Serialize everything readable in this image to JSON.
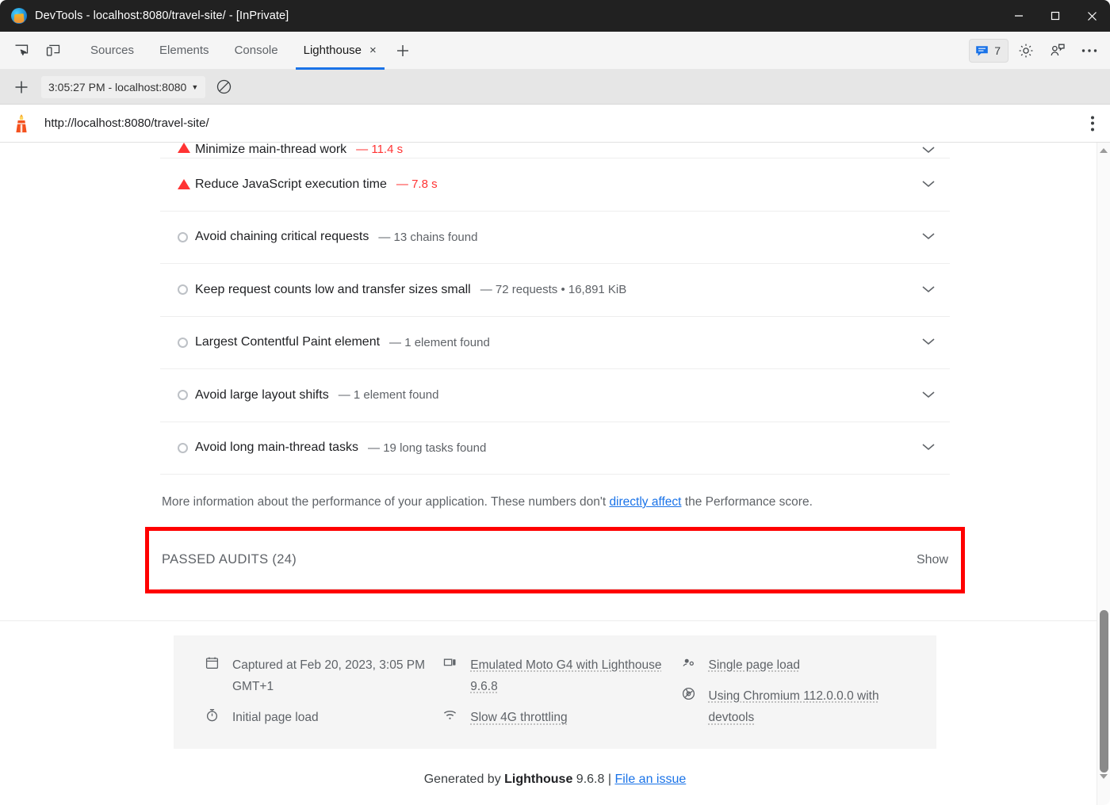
{
  "window": {
    "title": "DevTools - localhost:8080/travel-site/ - [InPrivate]",
    "logo_icon": "edge-logo-icon",
    "minimize_icon": "minimize-icon",
    "maximize_icon": "maximize-icon",
    "close_icon": "close-icon"
  },
  "devtools": {
    "inspect_icon": "inspect-element-icon",
    "device_icon": "device-toolbar-icon",
    "tabs": [
      {
        "label": "Sources",
        "active": false
      },
      {
        "label": "Elements",
        "active": false
      },
      {
        "label": "Console",
        "active": false
      },
      {
        "label": "Lighthouse",
        "active": true
      }
    ],
    "tab_close_glyph": "×",
    "add_tab_glyph": "+",
    "messages_count": "7",
    "messages_icon": "message-bubble-icon",
    "settings_icon": "gear-icon",
    "feedback_icon": "feedback-icon",
    "more_icon": "more-horizontal-icon",
    "accent_color": "#1a73e8"
  },
  "lighthouse_toolbar": {
    "add_glyph": "+",
    "run_label": "3:05:27 PM - localhost:8080",
    "caret_glyph": "▼",
    "clear_icon": "clear-no-entry-icon"
  },
  "report_header": {
    "lighthouse_icon": "lighthouse-icon",
    "url": "http://localhost:8080/travel-site/",
    "menu_icon": "kebab-menu-icon"
  },
  "audits": [
    {
      "icon": "warning-triangle-icon",
      "status": "fail",
      "title": "Minimize main-thread work",
      "dash": "—",
      "meta": "11.4 s",
      "meta_red": true,
      "chevron": "chevron-down-icon",
      "clipped": true
    },
    {
      "icon": "warning-triangle-icon",
      "status": "fail",
      "title": "Reduce JavaScript execution time",
      "dash": "—",
      "meta": "7.8 s",
      "meta_red": true,
      "chevron": "chevron-down-icon",
      "clipped": false
    },
    {
      "icon": "info-circle-icon",
      "status": "info",
      "title": "Avoid chaining critical requests",
      "dash": "—",
      "meta": "13 chains found",
      "meta_red": false,
      "chevron": "chevron-down-icon",
      "clipped": false
    },
    {
      "icon": "info-circle-icon",
      "status": "info",
      "title": "Keep request counts low and transfer sizes small",
      "dash": "—",
      "meta": "72 requests • 16,891 KiB",
      "meta_red": false,
      "chevron": "chevron-down-icon",
      "clipped": false
    },
    {
      "icon": "info-circle-icon",
      "status": "info",
      "title": "Largest Contentful Paint element",
      "dash": "—",
      "meta": "1 element found",
      "meta_red": false,
      "chevron": "chevron-down-icon",
      "clipped": false
    },
    {
      "icon": "info-circle-icon",
      "status": "info",
      "title": "Avoid large layout shifts",
      "dash": "—",
      "meta": "1 element found",
      "meta_red": false,
      "chevron": "chevron-down-icon",
      "clipped": false
    },
    {
      "icon": "info-circle-icon",
      "status": "info",
      "title": "Avoid long main-thread tasks",
      "dash": "—",
      "meta": "19 long tasks found",
      "meta_red": false,
      "chevron": "chevron-down-icon",
      "clipped": false
    }
  ],
  "more_info": {
    "text_before": "More information about the performance of your application. These numbers don't ",
    "link": "directly affect",
    "text_after": " the Performance score."
  },
  "passed_audits": {
    "label": "PASSED AUDITS (24)",
    "show_label": "Show",
    "highlight_color": "#ff0000"
  },
  "metadata": {
    "columns": [
      {
        "items": [
          {
            "icon": "calendar-icon",
            "text": "Captured at Feb 20, 2023, 3:05 PM GMT+1",
            "dotted": false
          },
          {
            "icon": "stopwatch-icon",
            "text": "Initial page load",
            "dotted": false
          }
        ]
      },
      {
        "items": [
          {
            "icon": "devices-icon",
            "text": "Emulated Moto G4 with Lighthouse 9.6.8",
            "dotted": true
          },
          {
            "icon": "network-throttle-icon",
            "text": "Slow 4G throttling",
            "dotted": true
          }
        ]
      },
      {
        "items": [
          {
            "icon": "single-page-load-icon",
            "text": "Single page load",
            "dotted": true
          },
          {
            "icon": "chromium-icon",
            "text": "Using Chromium 112.0.0.0 with devtools",
            "dotted": true
          }
        ]
      }
    ]
  },
  "footer": {
    "generated_prefix": "Generated by ",
    "brand": "Lighthouse",
    "version": " 9.6.8 | ",
    "issue_link": "File an issue"
  },
  "scrollbar": {
    "up_arrow_icon": "scroll-up-arrow-icon",
    "down_arrow_icon": "scroll-down-arrow-icon",
    "thumb": "scroll-thumb"
  }
}
